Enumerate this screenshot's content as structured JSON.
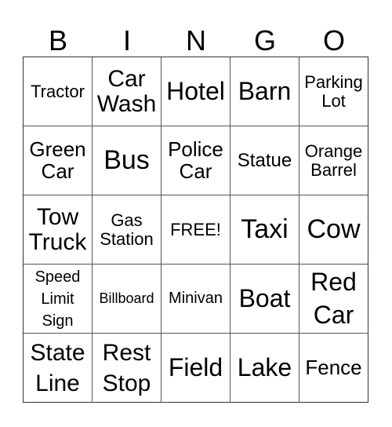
{
  "header": {
    "letters": [
      "B",
      "I",
      "N",
      "G",
      "O"
    ]
  },
  "board": {
    "rows": [
      [
        "Tractor",
        "Car Wash",
        "Hotel",
        "Barn",
        "Parking Lot"
      ],
      [
        "Green Car",
        "Bus",
        "Police Car",
        "Statue",
        "Orange Barrel"
      ],
      [
        "Tow Truck",
        "Gas Station",
        "FREE!",
        "Taxi",
        "Cow"
      ],
      [
        "Speed Limit Sign",
        "Billboard",
        "Minivan",
        "Boat",
        "Red Car"
      ],
      [
        "State Line",
        "Rest Stop",
        "Field",
        "Lake",
        "Fence"
      ]
    ],
    "free_space": "FREE!"
  }
}
